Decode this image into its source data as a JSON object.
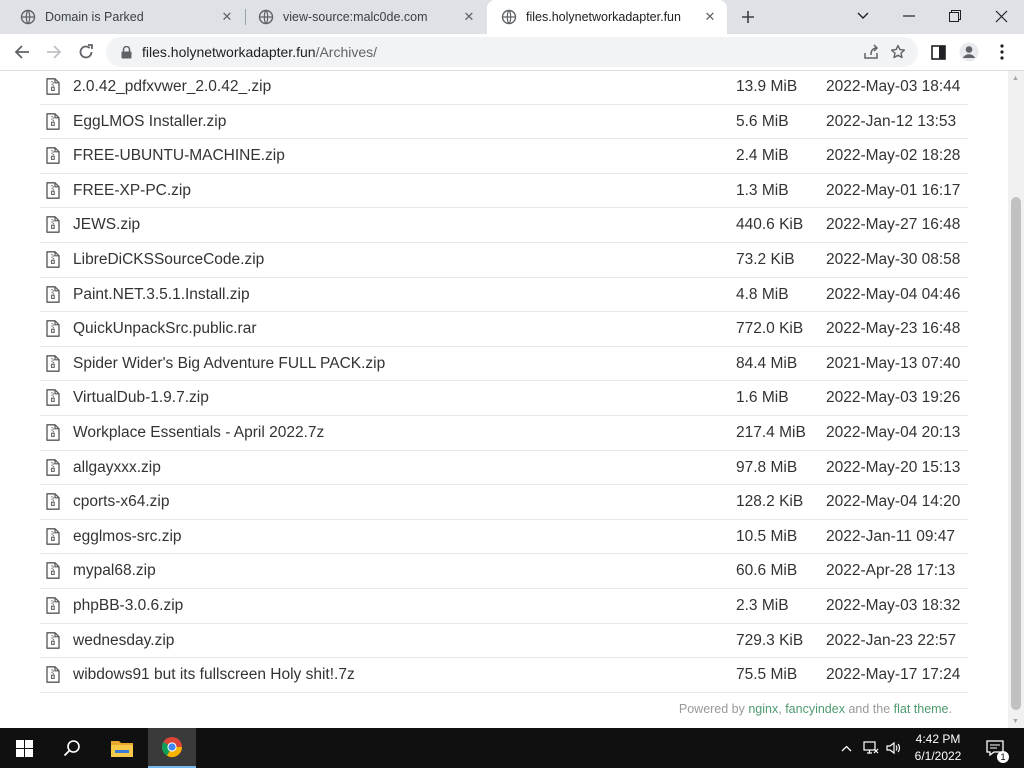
{
  "tabs": [
    {
      "title": "Domain is Parked"
    },
    {
      "title": "view-source:malc0de.com"
    },
    {
      "title": "files.holynetworkadapter.fun"
    }
  ],
  "address_bar": {
    "host": "files.holynetworkadapter.fun",
    "path": "/Archives/"
  },
  "files": [
    {
      "name": "2.0.42_pdfxvwer_2.0.42_.zip",
      "size": "13.9 MiB",
      "date": "2022-May-03 18:44"
    },
    {
      "name": "EggLMOS Installer.zip",
      "size": "5.6 MiB",
      "date": "2022-Jan-12 13:53"
    },
    {
      "name": "FREE-UBUNTU-MACHINE.zip",
      "size": "2.4 MiB",
      "date": "2022-May-02 18:28"
    },
    {
      "name": "FREE-XP-PC.zip",
      "size": "1.3 MiB",
      "date": "2022-May-01 16:17"
    },
    {
      "name": "JEWS.zip",
      "size": "440.6 KiB",
      "date": "2022-May-27 16:48"
    },
    {
      "name": "LibreDiCKSSourceCode.zip",
      "size": "73.2 KiB",
      "date": "2022-May-30 08:58"
    },
    {
      "name": "Paint.NET.3.5.1.Install.zip",
      "size": "4.8 MiB",
      "date": "2022-May-04 04:46"
    },
    {
      "name": "QuickUnpackSrc.public.rar",
      "size": "772.0 KiB",
      "date": "2022-May-23 16:48"
    },
    {
      "name": "Spider Wider's Big Adventure FULL PACK.zip",
      "size": "84.4 MiB",
      "date": "2021-May-13 07:40"
    },
    {
      "name": "VirtualDub-1.9.7.zip",
      "size": "1.6 MiB",
      "date": "2022-May-03 19:26"
    },
    {
      "name": "Workplace Essentials - April 2022.7z",
      "size": "217.4 MiB",
      "date": "2022-May-04 20:13"
    },
    {
      "name": "allgayxxx.zip",
      "size": "97.8 MiB",
      "date": "2022-May-20 15:13"
    },
    {
      "name": "cports-x64.zip",
      "size": "128.2 KiB",
      "date": "2022-May-04 14:20"
    },
    {
      "name": "egglmos-src.zip",
      "size": "10.5 MiB",
      "date": "2022-Jan-11 09:47"
    },
    {
      "name": "mypal68.zip",
      "size": "60.6 MiB",
      "date": "2022-Apr-28 17:13"
    },
    {
      "name": "phpBB-3.0.6.zip",
      "size": "2.3 MiB",
      "date": "2022-May-03 18:32"
    },
    {
      "name": "wednesday.zip",
      "size": "729.3 KiB",
      "date": "2022-Jan-23 22:57"
    },
    {
      "name": "wibdows91 but its fullscreen Holy shit!.7z",
      "size": "75.5 MiB",
      "date": "2022-May-17 17:24"
    }
  ],
  "footer": {
    "prefix": "Powered by ",
    "nginx": "nginx",
    "sep1": ", ",
    "fancyindex": "fancyindex",
    "middle": " and the ",
    "theme": "flat theme",
    "suffix": "."
  },
  "taskbar": {
    "time": "4:42 PM",
    "date": "6/1/2022",
    "notifications": "1"
  },
  "colors": {
    "link_green": "#4e9a6f",
    "row_border": "#e5e7ea",
    "taskbar": "#101010"
  }
}
